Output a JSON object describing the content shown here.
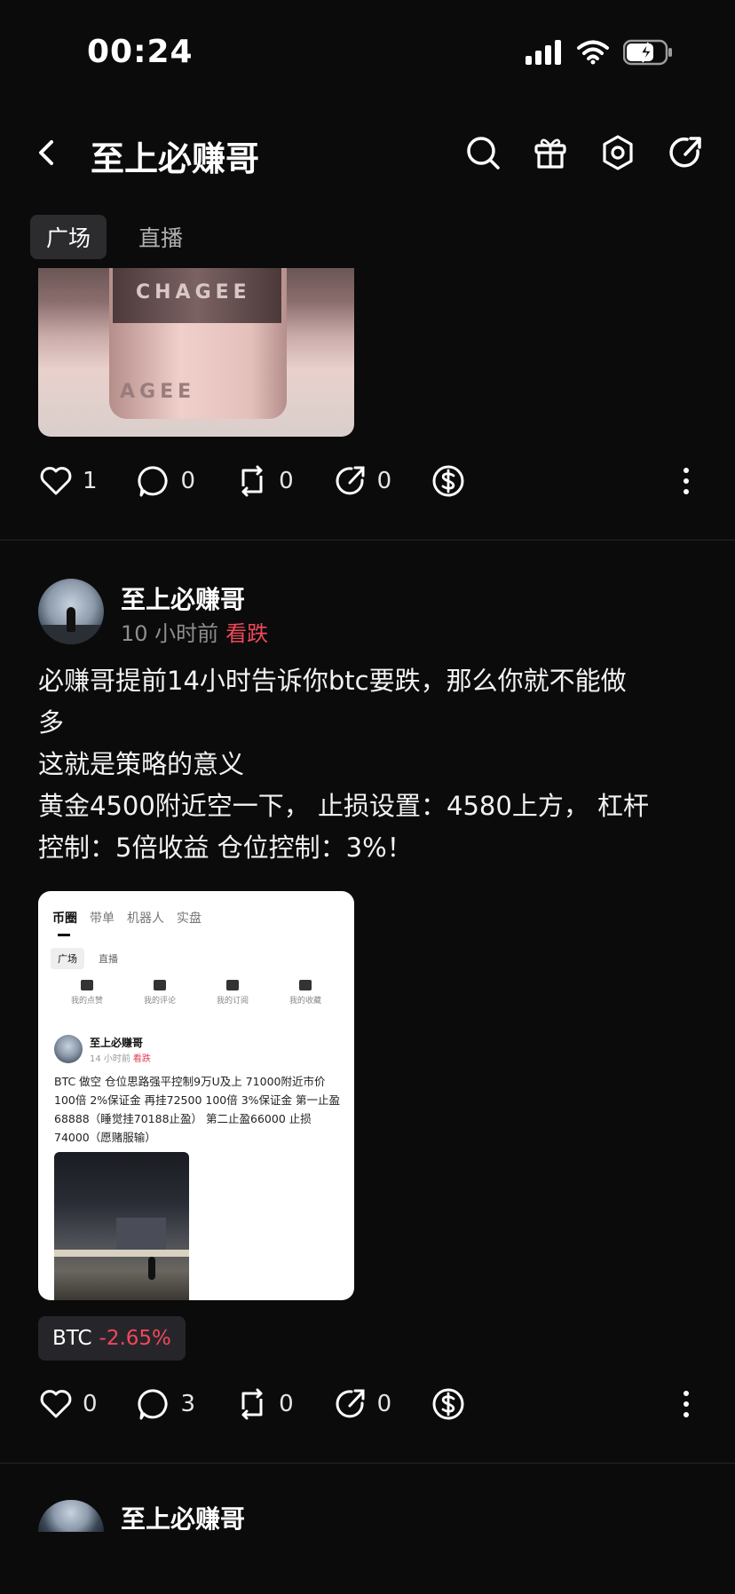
{
  "status": {
    "time": "00:24"
  },
  "header": {
    "title": "至上必赚哥"
  },
  "tabs": [
    {
      "label": "广场",
      "active": true
    },
    {
      "label": "直播",
      "active": false
    }
  ],
  "post1": {
    "image_brand_top": "CHAGEE",
    "image_brand_bottom": "AGEE",
    "actions": {
      "likes": "1",
      "comments": "0",
      "reposts": "0",
      "shares": "0"
    }
  },
  "post2": {
    "author": "至上必赚哥",
    "time": "10 小时前",
    "tag": "看跌",
    "text_lines": [
      "必赚哥提前14小时告诉你btc要跌，那么你就不能做",
      "多",
      "这就是策略的意义",
      "黄金4500附近空一下， 止损设置：4580上方， 杠杆",
      "控制：5倍收益 仓位控制：3%！"
    ],
    "screenshot": {
      "tabs": [
        "币圈",
        "带单",
        "机器人",
        "实盘"
      ],
      "subtabs": [
        "广场",
        "直播"
      ],
      "quick": [
        "我的点赞",
        "我的评论",
        "我的订阅",
        "我的收藏"
      ],
      "author": "至上必赚哥",
      "time": "14 小时前",
      "tag": "看跌",
      "text": "BTC 做空 仓位思路强平控制9万U及上 71000附近市价 100倍 2%保证金 再挂72500 100倍 3%保证金 第一止盈68888（睡觉挂70188止盈） 第二止盈66000 止损74000（愿赌服输）"
    },
    "ticker": {
      "symbol": "BTC",
      "change": "-2.65%"
    },
    "actions": {
      "likes": "0",
      "comments": "3",
      "reposts": "0",
      "shares": "0"
    }
  },
  "post3": {
    "author": "至上必赚哥"
  },
  "colors": {
    "background": "#0b0b0b",
    "down": "#f0485a",
    "chip": "#26262a"
  }
}
